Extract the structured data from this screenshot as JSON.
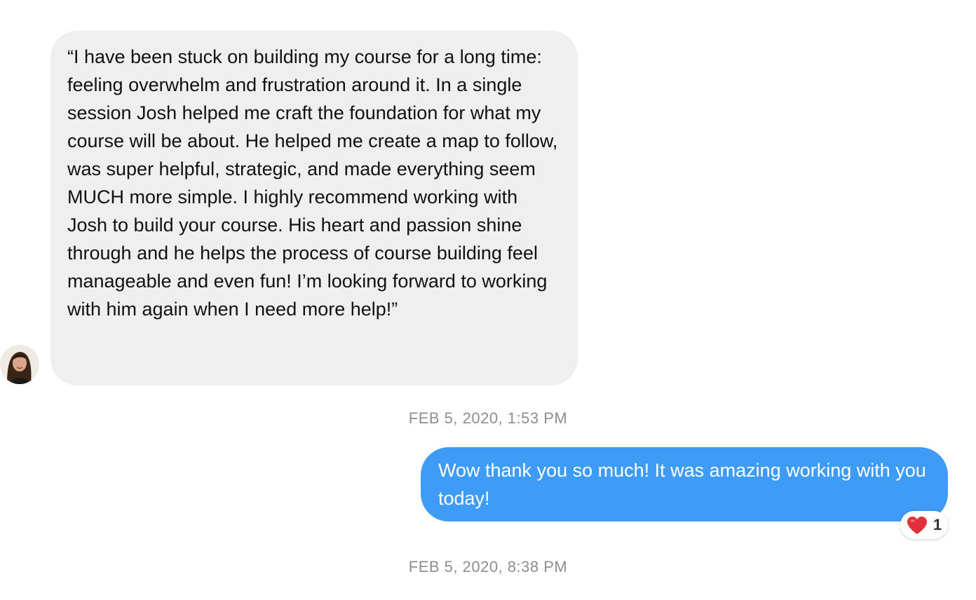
{
  "messages": [
    {
      "sender": "them",
      "text": "“I have been stuck on building my course for a long time: feeling overwhelm and frustration around it. In a single session Josh helped me craft the foundation for what my course will be about. He helped me create a map to follow, was super helpful, strategic, and made everything seem MUCH more simple. I highly recommend working with Josh to build your course. His heart and passion shine through and he helps the process of course building feel manageable and even fun! I’m looking forward to working with him again when I need more help!”",
      "timestamp": "FEB 5, 2020, 1:53 PM"
    },
    {
      "sender": "me",
      "text": "Wow thank you so much! It was amazing working with you today!",
      "reaction": {
        "icon": "heart-icon",
        "count": "1"
      },
      "timestamp": "FEB 5, 2020, 8:38 PM"
    }
  ],
  "colors": {
    "incoming_bubble": "#efefef",
    "outgoing_bubble": "#3e9bf6",
    "timestamp": "#8e8e8e",
    "heart": "#e0303a"
  }
}
